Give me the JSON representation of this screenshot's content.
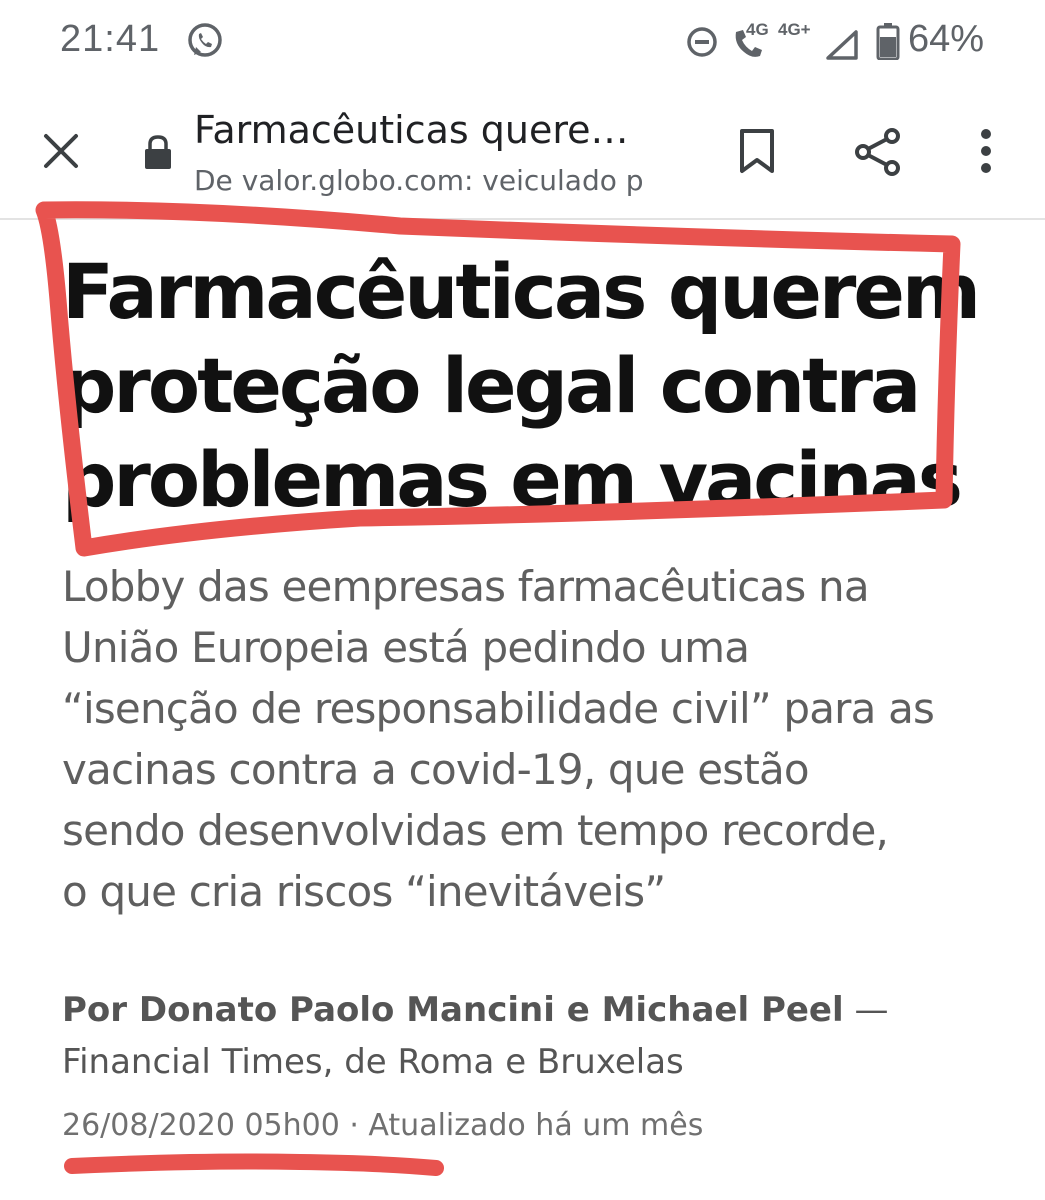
{
  "status_bar": {
    "time": "21:41",
    "net_call": "4G",
    "net_data": "4G+",
    "battery": "64%",
    "icons": [
      "whatsapp-icon",
      "do-not-disturb-icon",
      "wifi-call-icon",
      "signal-icon",
      "battery-icon"
    ]
  },
  "toolbar": {
    "title": "Farmacêuticas quere…",
    "url": "De valor.globo.com: veiculado p",
    "icons": [
      "close-icon",
      "lock-icon",
      "bookmark-icon",
      "share-icon",
      "more-vert-icon"
    ]
  },
  "article": {
    "headline_lines": [
      "Farmacêuticas querem",
      "proteção legal contra",
      "problemas em vacinas"
    ],
    "dek_lines": [
      "Lobby das eempresas farmacêuticas na",
      "União Europeia está pedindo uma",
      "“isenção de responsabilidade civil” para as",
      "vacinas contra a covid-19, que estão",
      "sendo desenvolvidas em tempo recorde,",
      "o que cria riscos “inevitáveis”"
    ],
    "byline_authors": "Por Donato Paolo Mancini e Michael Peel",
    "byline_dash": " —",
    "byline_source": "Financial Times, de Roma e Bruxelas",
    "date": "26/08/2020 05h00",
    "date_separator": " · ",
    "updated": "Atualizado há um mês"
  },
  "annotation_color": "#e8534f"
}
